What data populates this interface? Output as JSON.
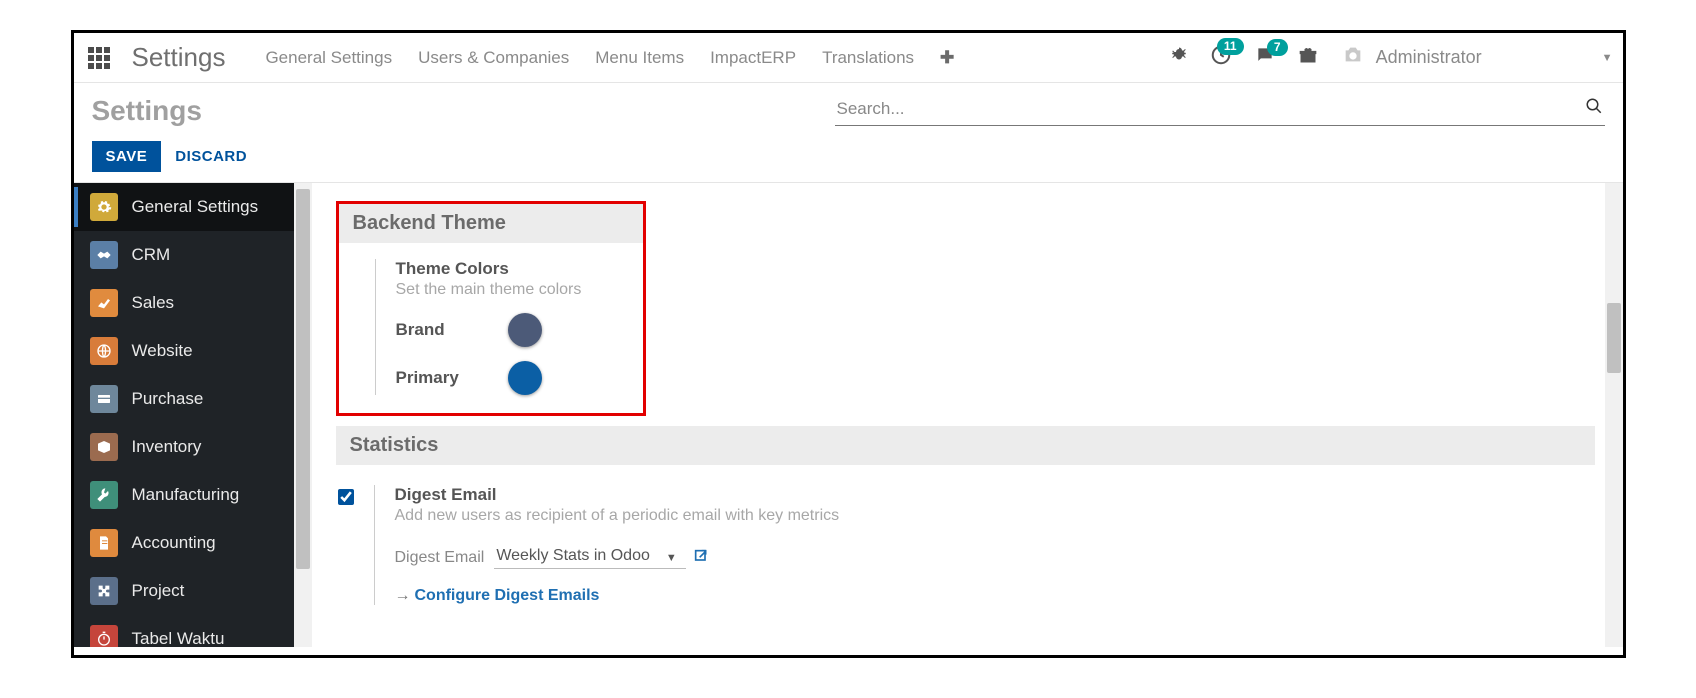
{
  "header": {
    "brand": "Settings",
    "menu": [
      "General Settings",
      "Users & Companies",
      "Menu Items",
      "ImpactERP",
      "Translations"
    ],
    "badges": {
      "activities": "11",
      "messages": "7"
    },
    "user": "Administrator"
  },
  "controlpanel": {
    "breadcrumb": "Settings",
    "search_placeholder": "Search...",
    "save_label": "SAVE",
    "discard_label": "DISCARD"
  },
  "sidebar": {
    "items": [
      {
        "label": "General Settings"
      },
      {
        "label": "CRM"
      },
      {
        "label": "Sales"
      },
      {
        "label": "Website"
      },
      {
        "label": "Purchase"
      },
      {
        "label": "Inventory"
      },
      {
        "label": "Manufacturing"
      },
      {
        "label": "Accounting"
      },
      {
        "label": "Project"
      },
      {
        "label": "Tabel Waktu"
      }
    ]
  },
  "sections": {
    "backend_theme": {
      "title": "Backend Theme",
      "theme_colors": {
        "title": "Theme Colors",
        "desc": "Set the main theme colors",
        "brand_label": "Brand",
        "brand_color": "#4c5a78",
        "primary_label": "Primary",
        "primary_color": "#0b5fa5"
      }
    },
    "statistics": {
      "title": "Statistics",
      "digest": {
        "checked": true,
        "title": "Digest Email",
        "desc": "Add new users as recipient of a periodic email with key metrics",
        "field_label": "Digest Email",
        "field_value": "Weekly Stats in Odoo",
        "configure_link": "Configure Digest Emails"
      }
    }
  }
}
